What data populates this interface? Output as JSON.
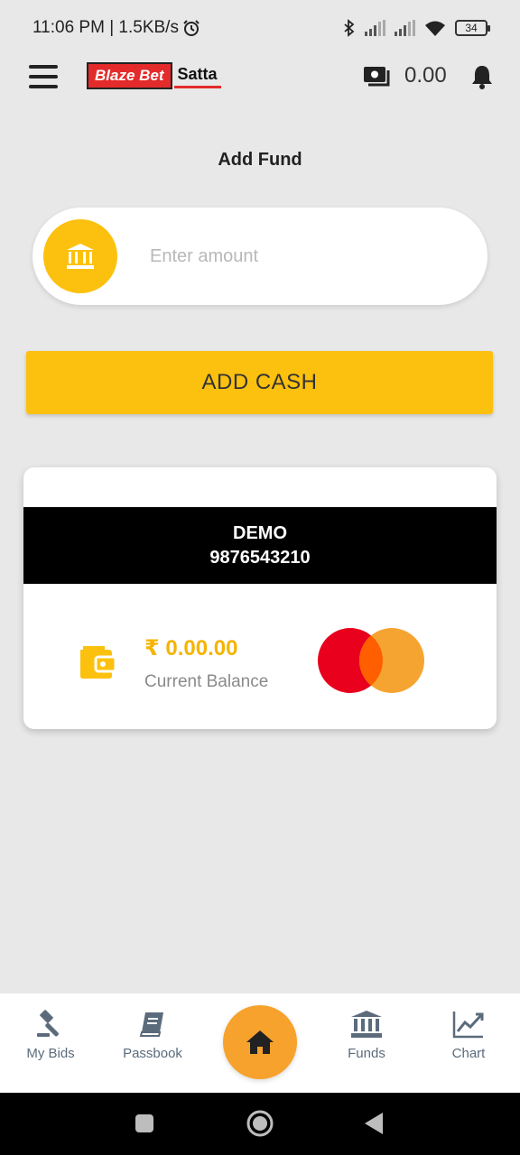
{
  "status_bar": {
    "time_speed": "11:06 PM | 1.5KB/s",
    "battery": "34"
  },
  "header": {
    "logo_left": "Blaze Bet",
    "logo_right": "Satta",
    "wallet_amount": "0.00"
  },
  "page": {
    "title": "Add Fund",
    "amount_placeholder": "Enter amount",
    "add_cash_label": "ADD CASH"
  },
  "card": {
    "name": "DEMO",
    "phone": "9876543210",
    "balance": "₹ 0.00.00",
    "balance_label": "Current Balance"
  },
  "bottom_nav": {
    "items": [
      {
        "label": "My Bids",
        "icon": "gavel-icon"
      },
      {
        "label": "Passbook",
        "icon": "book-icon"
      },
      {
        "label": "",
        "icon": "home-icon"
      },
      {
        "label": "Funds",
        "icon": "bank-icon"
      },
      {
        "label": "Chart",
        "icon": "chart-icon"
      }
    ]
  },
  "colors": {
    "accent_yellow": "#fcc10f",
    "home_orange": "#f7a22c",
    "nav_gray": "#5b6b7c",
    "balance_yellow": "#f5b400"
  }
}
